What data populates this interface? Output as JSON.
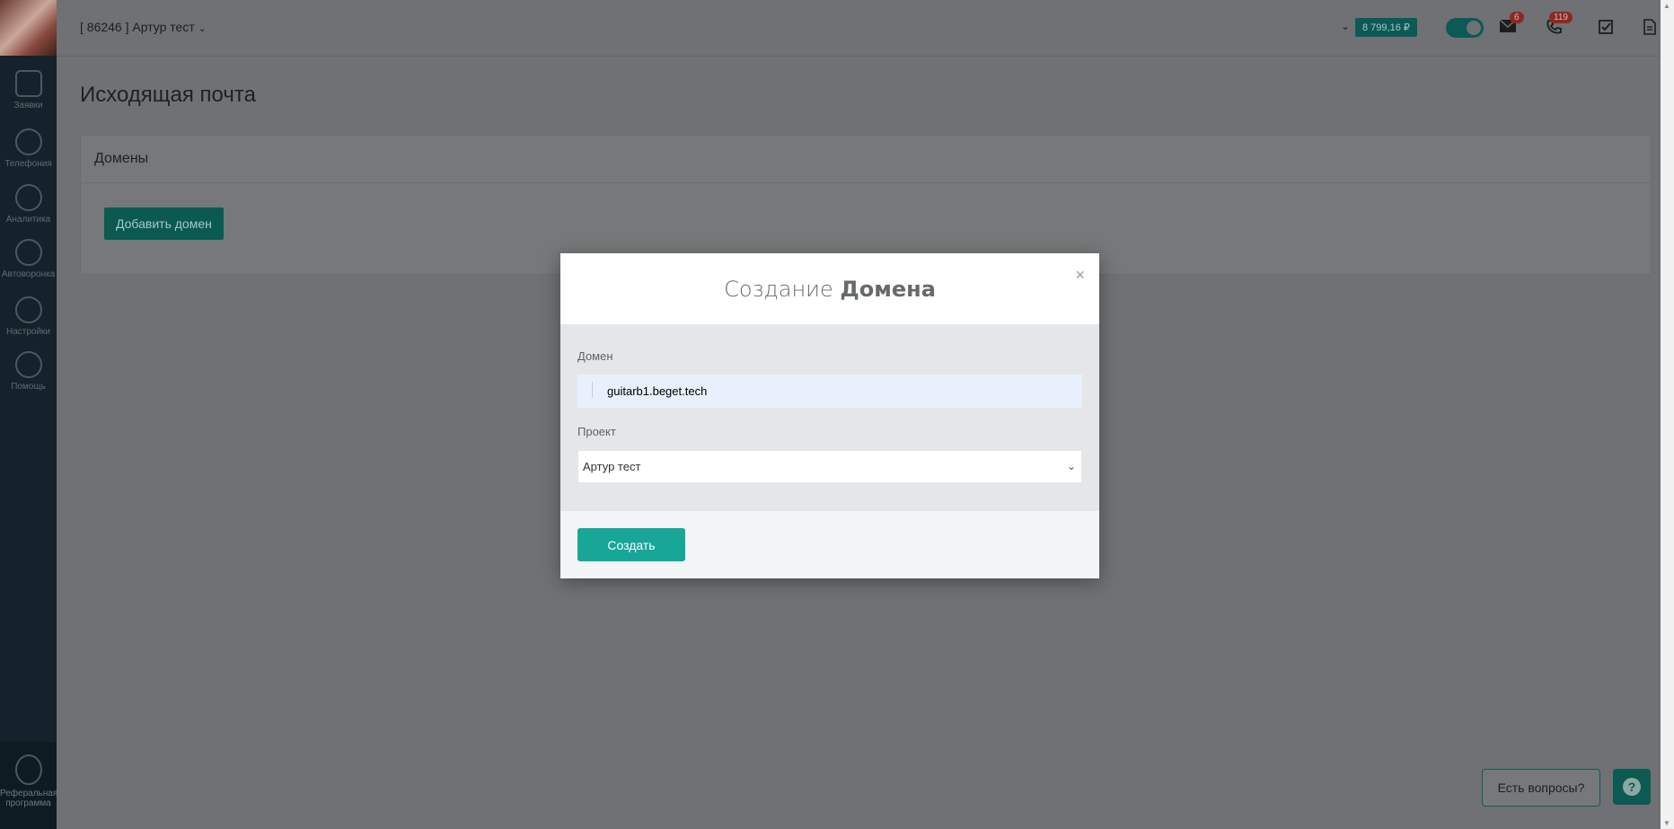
{
  "header": {
    "account": "[ 86246 ] Артур тест",
    "balance": "8 799,16 ₽",
    "mail_badge": "6",
    "calls_badge": "119"
  },
  "sidebar": {
    "items": [
      {
        "label": "Заявки",
        "icon": "requests-icon"
      },
      {
        "label": "Телефония",
        "icon": "phone-icon"
      },
      {
        "label": "Аналитика",
        "icon": "analytics-icon"
      },
      {
        "label": "Автоворонка",
        "icon": "autofunnel-icon"
      },
      {
        "label": "Настройки",
        "icon": "settings-icon"
      },
      {
        "label": "Помощь",
        "icon": "help-icon"
      }
    ],
    "referral_label_1": "Реферальная",
    "referral_label_2": "программа"
  },
  "page": {
    "title": "Исходящая почта",
    "panel_title": "Домены",
    "add_domain_label": "Добавить домен"
  },
  "modal": {
    "title_light": "Создание",
    "title_bold": "Домена",
    "close": "×",
    "domain_label": "Домен",
    "domain_value": "guitarb1.beget.tech",
    "project_label": "Проект",
    "project_value": "Артур тест",
    "submit_label": "Создать"
  },
  "help": {
    "questions_label": "Есть вопросы?",
    "help_glyph": "?"
  }
}
